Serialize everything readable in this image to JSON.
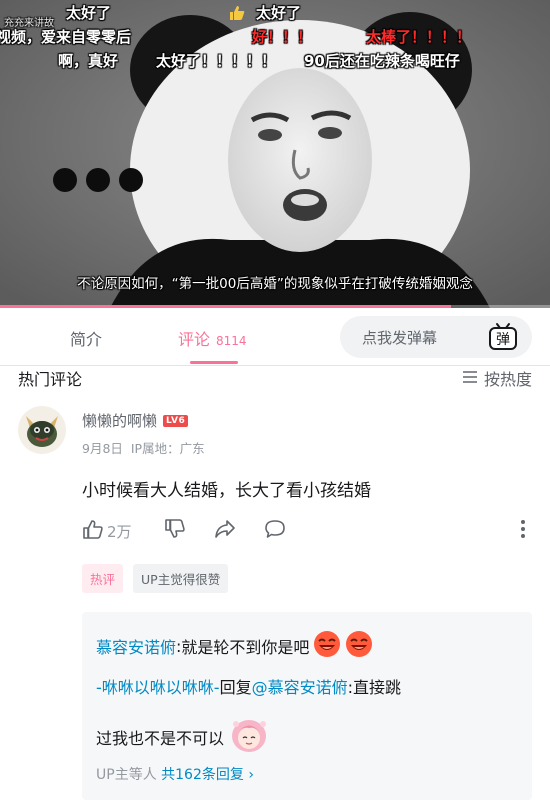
{
  "video": {
    "subtitle": "不论原因如何，“第一批00后高婚”的现象似乎在打破传统婚姻观念",
    "progress": 0.82,
    "danmaku": [
      {
        "text": "充充来讲故",
        "style": "small"
      },
      {
        "text": "太好了",
        "style": "white"
      },
      {
        "text": "视频，爱来自零零后",
        "style": "white"
      },
      {
        "text": "啊，真好",
        "style": "white"
      },
      {
        "text": "太好了！！！！！",
        "style": "white"
      },
      {
        "text": "太好了",
        "style": "white"
      },
      {
        "text": "好！！！",
        "style": "red"
      },
      {
        "text": "太棒了！！！！",
        "style": "red"
      },
      {
        "text": "90后还在吃辣条喝旺仔",
        "style": "white"
      }
    ]
  },
  "tabs": {
    "intro": "简介",
    "comments": "评论",
    "comments_count": "8114",
    "danmaku_placeholder": "点我发弹幕",
    "danmaku_button": "弹"
  },
  "hot": {
    "title": "热门评论",
    "sort_label": "按热度"
  },
  "comment": {
    "username": "懒懒的啊懒",
    "level": "LV6",
    "date": "9月8日",
    "ip": "IP属地：广东",
    "text": "小时候看大人结婚，长大了看小孩结婚",
    "likes": "2万",
    "tags": [
      "热评",
      "UP主觉得很赞"
    ]
  },
  "replies": {
    "items": [
      {
        "user": "慕容安诺俯",
        "sep": ": ",
        "text": "就是轮不到你是吧"
      },
      {
        "user": "-咻咻以咻以咻咻-",
        "mid": " 回复 ",
        "target": "@慕容安诺俯",
        "text": " :直接跳"
      },
      {
        "text": "过我也不是不可以"
      }
    ],
    "more_prefix": "UP主等人 ",
    "more_link": "共162条回复",
    "more_arrow": "›"
  },
  "colors": {
    "accent": "#fb7299",
    "link": "#008ac5",
    "level_badge": "#ee4b4b"
  },
  "icons": [
    "thumb-up-icon",
    "list-sort-icon",
    "like-icon",
    "dislike-icon",
    "share-icon",
    "comment-icon",
    "more-vertical-icon",
    "danmaku-tv-icon",
    "laughing-emoji-icon"
  ]
}
